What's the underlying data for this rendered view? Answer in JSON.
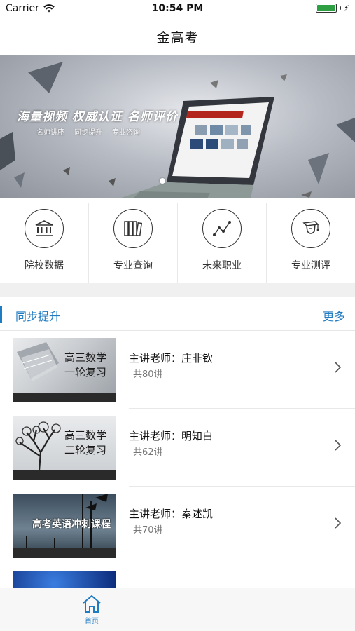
{
  "status_bar": {
    "carrier": "Carrier",
    "time": "10:54 PM",
    "battery_level": 1.0,
    "wifi_icon": "wifi-icon"
  },
  "nav": {
    "title": "金高考"
  },
  "banner": {
    "headline": "海量视频 权威认证 名师评价",
    "tags": [
      "名师讲座",
      "同步提升",
      "专业咨询"
    ],
    "page_indicator": {
      "count": 1,
      "active": 0
    }
  },
  "categories": [
    {
      "label": "院校数据",
      "icon": "university-icon"
    },
    {
      "label": "专业查询",
      "icon": "books-icon"
    },
    {
      "label": "未来职业",
      "icon": "trend-line-icon"
    },
    {
      "label": "专业测评",
      "icon": "graduation-cap-icon"
    }
  ],
  "section": {
    "title": "同步提升",
    "more_label": "更多"
  },
  "courses": [
    {
      "thumb_title_line1": "高三数学",
      "thumb_title_line2": "一轮复习",
      "teacher": "主讲老师：庄非钦",
      "count": "共80讲"
    },
    {
      "thumb_title_line1": "高三数学",
      "thumb_title_line2": "二轮复习",
      "teacher": "主讲老师：明知白",
      "count": "共62讲"
    },
    {
      "thumb_title_line1": "高考英语冲刺课程",
      "thumb_title_line2": "",
      "teacher": "主讲老师：秦述凯",
      "count": "共70讲"
    }
  ],
  "tab_bar": {
    "items": [
      {
        "label": "首页",
        "icon": "home-icon",
        "active": true
      }
    ]
  },
  "colors": {
    "accent": "#1f7bc2",
    "battery": "#2ea043"
  }
}
